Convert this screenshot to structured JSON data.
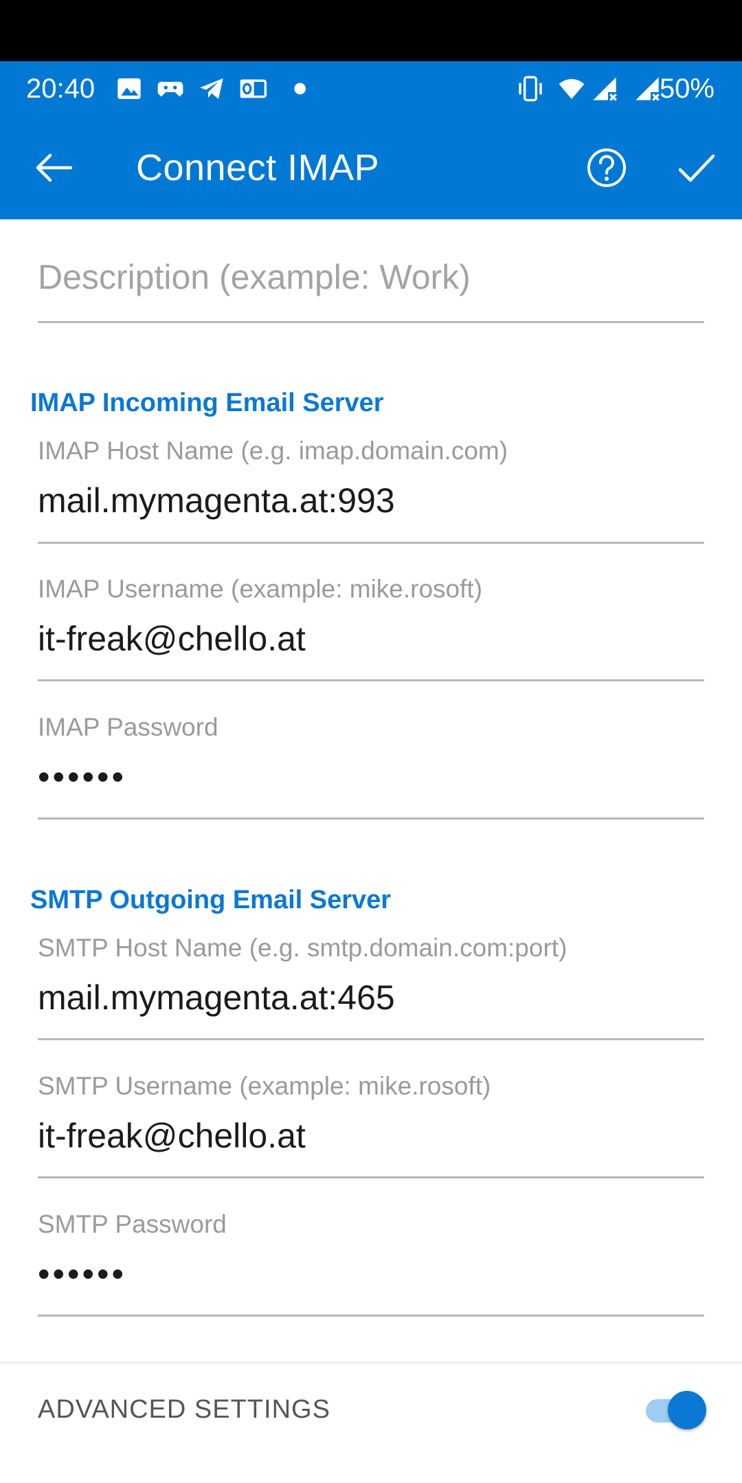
{
  "status_bar": {
    "time": "20:40",
    "battery": "50%",
    "icons": [
      "image-icon",
      "game-controller-icon",
      "telegram-icon",
      "outlook-icon",
      "dot-icon",
      "vibrate-icon",
      "wifi-icon",
      "signal-icon",
      "signal-icon"
    ]
  },
  "app_bar": {
    "title": "Connect IMAP",
    "icons": [
      "back-arrow-icon",
      "help-icon",
      "checkmark-icon"
    ]
  },
  "description_field": {
    "placeholder": "Description (example: Work)",
    "value": ""
  },
  "imap_section": {
    "header": "IMAP Incoming Email Server",
    "host": {
      "label": "IMAP Host Name (e.g. imap.domain.com)",
      "value": "mail.mymagenta.at:993"
    },
    "username": {
      "label": "IMAP Username (example: mike.rosoft)",
      "value": "it-freak@chello.at"
    },
    "password": {
      "label": "IMAP Password",
      "value": "••••••"
    }
  },
  "smtp_section": {
    "header": "SMTP Outgoing Email Server",
    "host": {
      "label": "SMTP Host Name (e.g. smtp.domain.com:port)",
      "value": "mail.mymagenta.at:465"
    },
    "username": {
      "label": "SMTP Username (example: mike.rosoft)",
      "value": "it-freak@chello.at"
    },
    "password": {
      "label": "SMTP Password",
      "value": "••••••"
    }
  },
  "advanced": {
    "label": "ADVANCED SETTINGS",
    "enabled": true
  },
  "colors": {
    "accent": "#0078d4",
    "section_header": "#0a78d4"
  }
}
